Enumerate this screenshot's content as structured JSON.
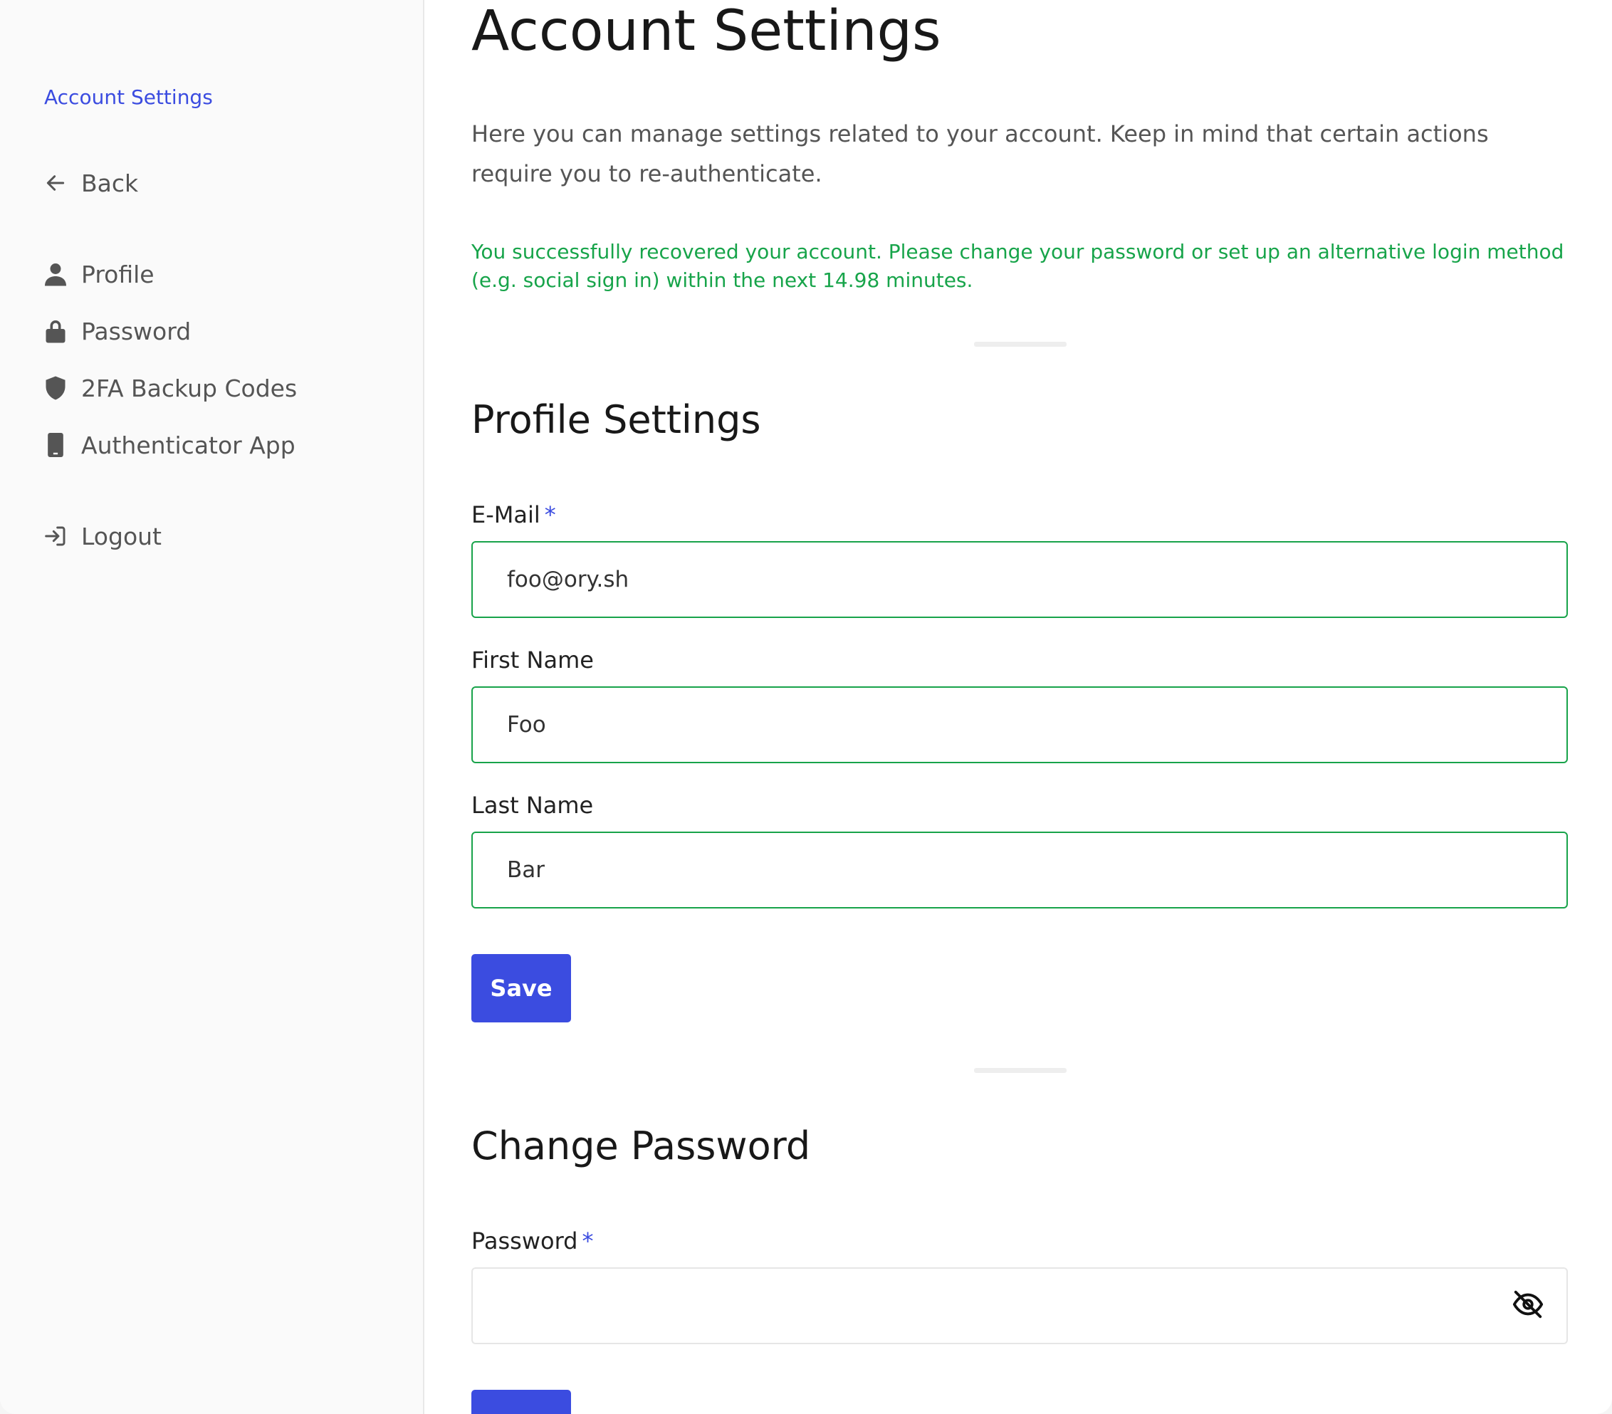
{
  "sidebar": {
    "title": "Account Settings",
    "back_label": "Back",
    "items": [
      {
        "label": "Profile",
        "icon": "user-icon"
      },
      {
        "label": "Password",
        "icon": "lock-icon"
      },
      {
        "label": "2FA Backup Codes",
        "icon": "shield-icon"
      },
      {
        "label": "Authenticator App",
        "icon": "phone-icon"
      }
    ],
    "logout_label": "Logout"
  },
  "main": {
    "title": "Account Settings",
    "intro": "Here you can manage settings related to your account. Keep in mind that certain actions require you to re-authenticate.",
    "success_message": "You successfully recovered your account. Please change your password or set up an alternative login method (e.g. social sign in) within the next 14.98 minutes.",
    "profile": {
      "title": "Profile Settings",
      "email_label": "E-Mail",
      "email_required": "*",
      "email_value": "foo@ory.sh",
      "first_name_label": "First Name",
      "first_name_value": "Foo",
      "last_name_label": "Last Name",
      "last_name_value": "Bar",
      "save_label": "Save"
    },
    "password": {
      "title": "Change Password",
      "password_label": "Password",
      "password_required": "*",
      "password_value": ""
    }
  },
  "colors": {
    "accent": "#3b4ce0",
    "success": "#17a44a",
    "input_border_valid": "#18a34a"
  }
}
